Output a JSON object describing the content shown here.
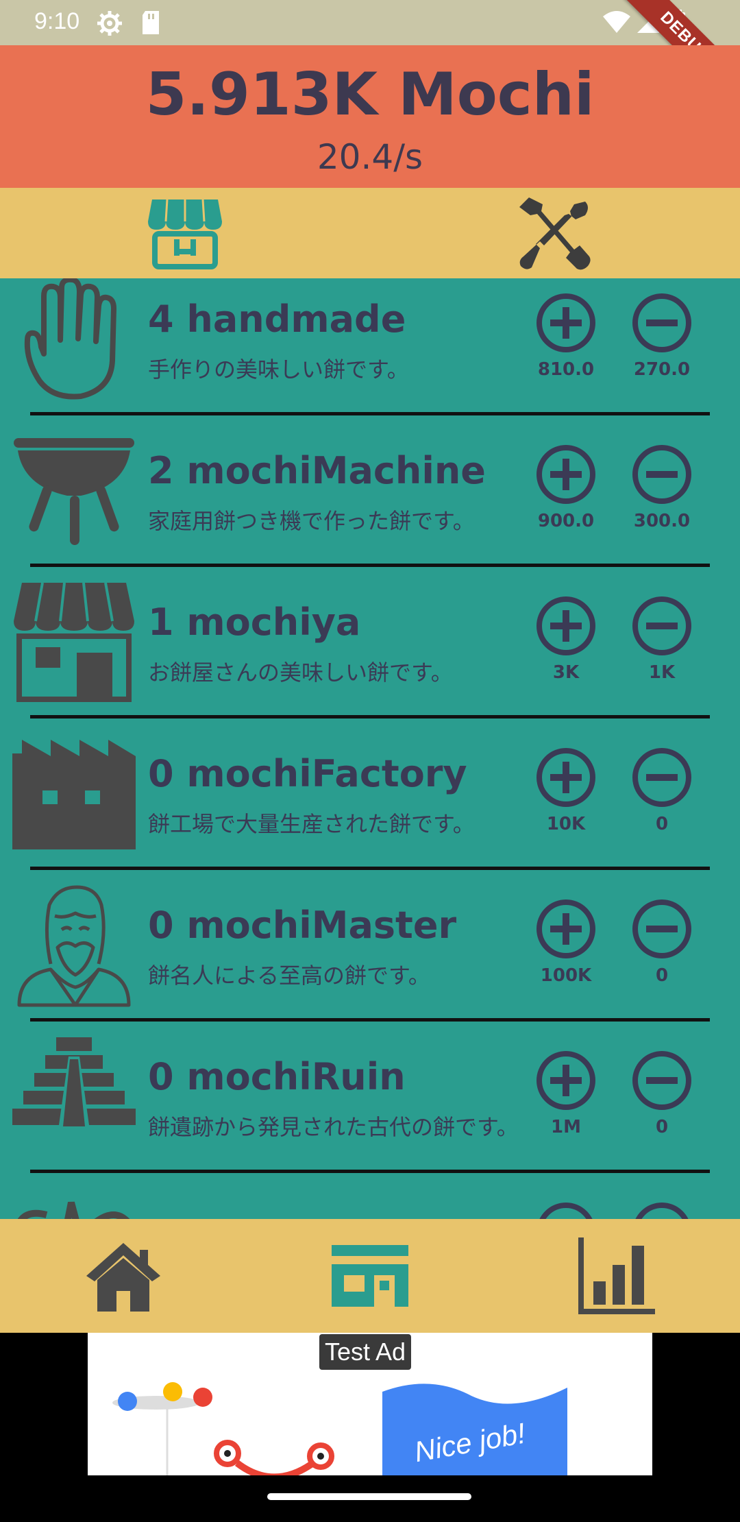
{
  "status": {
    "time": "9:10",
    "debug_label": "DEBUG"
  },
  "header": {
    "total": "5.913K  Mochi",
    "rate": "20.4/s"
  },
  "tabs": [
    {
      "name": "shop",
      "icon": "store-icon"
    },
    {
      "name": "tools",
      "icon": "tools-icon"
    }
  ],
  "items": [
    {
      "count": "4",
      "name": "handmade",
      "title": "4  handmade",
      "description": "手作りの美味しい餅です。",
      "buy_cost": "810.0",
      "sell_value": "270.0",
      "icon": "hand-icon"
    },
    {
      "count": "2",
      "name": "mochiMachine",
      "title": "2  mochiMachine",
      "description": "家庭用餅つき機で作った餅です。",
      "buy_cost": "900.0",
      "sell_value": "300.0",
      "icon": "grill-icon"
    },
    {
      "count": "1",
      "name": "mochiya",
      "title": "1  mochiya",
      "description": "お餅屋さんの美味しい餅です。",
      "buy_cost": "3K",
      "sell_value": "1K",
      "icon": "shop-icon"
    },
    {
      "count": "0",
      "name": "mochiFactory",
      "title": "0  mochiFactory",
      "description": "餅工場で大量生産された餅です。",
      "buy_cost": "10K",
      "sell_value": "0",
      "icon": "factory-icon"
    },
    {
      "count": "0",
      "name": "mochiMaster",
      "title": "0  mochiMaster",
      "description": "餅名人による至高の餅です。",
      "buy_cost": "100K",
      "sell_value": "0",
      "icon": "master-icon"
    },
    {
      "count": "0",
      "name": "mochiRuin",
      "title": "0  mochiRuin",
      "description": "餅遺跡から発見された古代の餅です。",
      "buy_cost": "1M",
      "sell_value": "0",
      "icon": "pyramid-icon"
    }
  ],
  "bottom_nav": [
    {
      "name": "home",
      "icon": "home-icon"
    },
    {
      "name": "store",
      "icon": "store-icon",
      "active": true
    },
    {
      "name": "stats",
      "icon": "chart-icon"
    }
  ],
  "ad": {
    "label": "Test Ad",
    "banner_text": "Nice job!"
  },
  "colors": {
    "header": "#e97152",
    "tabs": "#e8c46c",
    "list": "#2a9d8f",
    "text": "#3b3a55",
    "active_icon": "#2a9d8f",
    "icon": "#494949"
  }
}
